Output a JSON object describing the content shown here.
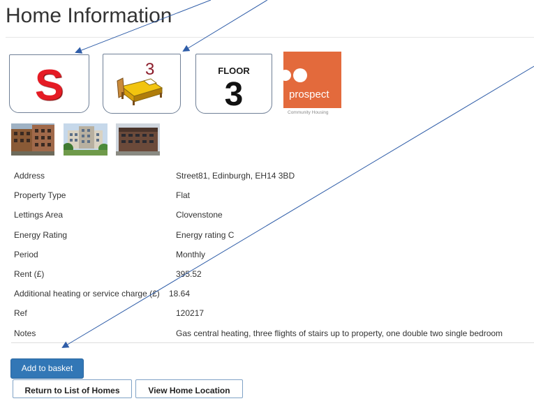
{
  "page": {
    "title": "Home Information"
  },
  "badges": {
    "property_type_letter": "S",
    "bedrooms": "3",
    "floor_label": "FLOOR",
    "floor_number": "3",
    "letter_color": "#e51b24",
    "bed_count_color": "#8b1c2a",
    "icons": [
      "letter-s-badge",
      "bed-icon",
      "floor-badge"
    ]
  },
  "landlord": {
    "name": "prospect",
    "subtitle": "Community Housing",
    "brand_color": "#e36a3c"
  },
  "photos": [
    {
      "name": "building-photo-1"
    },
    {
      "name": "building-photo-2"
    },
    {
      "name": "building-photo-3"
    }
  ],
  "details": [
    {
      "label": "Address",
      "value": "Street81, Edinburgh, EH14 3BD"
    },
    {
      "label": "Property Type",
      "value": "Flat"
    },
    {
      "label": "Lettings Area",
      "value": "Clovenstone"
    },
    {
      "label": "Energy Rating",
      "value": "Energy rating C"
    },
    {
      "label": "Period",
      "value": "Monthly"
    },
    {
      "label": "Rent (£)",
      "value": "395.52"
    },
    {
      "label": "Additional heating or service charge (£)",
      "value": "18.64"
    },
    {
      "label": "Ref",
      "value": "120217"
    },
    {
      "label": "Notes",
      "value": "Gas central heating, three flights of stairs up to property, one double two single bedroom"
    }
  ],
  "actions": {
    "add_to_basket": "Add to basket",
    "return_to_list": "Return to List of Homes",
    "view_location": "View Home Location",
    "primary_color": "#3277b6"
  },
  "annotations": {
    "arrow_color": "#2f5da8"
  }
}
